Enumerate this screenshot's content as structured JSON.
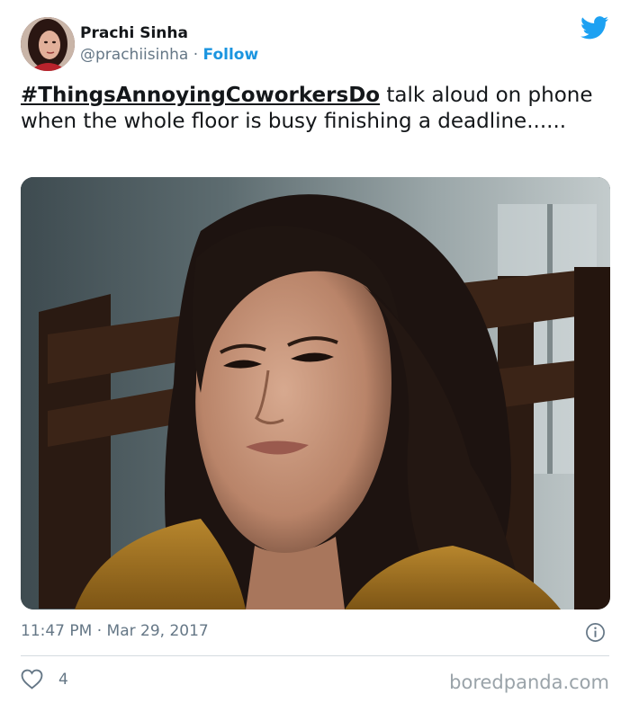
{
  "author": {
    "name": "Prachi Sinha",
    "handle": "@prachiisinha",
    "separator": "·",
    "follow_label": "Follow"
  },
  "tweet": {
    "hashtag": "#ThingsAnnoyingCoworkersDo",
    "text": " talk aloud on phone when the whole floor is busy finishing a deadline......"
  },
  "media": {
    "description_icon": "photo"
  },
  "meta": {
    "time": "11:47 PM",
    "separator": "·",
    "date": "Mar 29, 2017"
  },
  "engagement": {
    "like_count": "4"
  },
  "watermark": "boredpanda.com",
  "colors": {
    "twitter_blue": "#1da1f2",
    "follow_blue": "#1b95e0",
    "secondary_text": "#657786"
  },
  "icons": [
    "twitter-bird-icon",
    "info-icon",
    "heart-icon"
  ]
}
